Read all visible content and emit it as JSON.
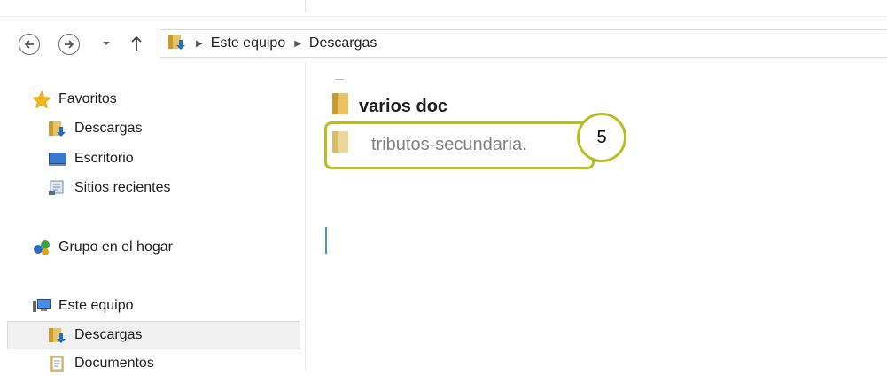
{
  "navigation": {
    "back_icon": "back-arrow-icon",
    "forward_icon": "forward-arrow-icon",
    "history_icon": "chevron-down-icon",
    "up_icon": "up-arrow-icon"
  },
  "address": {
    "segments": [
      "Este equipo",
      "Descargas"
    ]
  },
  "sidebar": {
    "favoritos": {
      "label": "Favoritos",
      "icon": "star-icon",
      "items": [
        {
          "label": "Descargas",
          "icon": "downloads-folder-icon"
        },
        {
          "label": "Escritorio",
          "icon": "desktop-icon"
        },
        {
          "label": "Sitios recientes",
          "icon": "recent-places-icon"
        }
      ]
    },
    "homegroup": {
      "label": "Grupo en el hogar",
      "icon": "homegroup-icon"
    },
    "computer": {
      "label": "Este equipo",
      "icon": "computer-icon",
      "items": [
        {
          "label": "Descargas",
          "icon": "downloads-folder-icon",
          "selected": true
        },
        {
          "label": "Documentos",
          "icon": "documents-icon"
        }
      ]
    }
  },
  "files": [
    {
      "name": "varios doc",
      "icon": "folder-icon"
    },
    {
      "name": "tributos-secundaria.",
      "icon": "folder-icon",
      "renaming": true
    }
  ],
  "annotation": {
    "label": "5",
    "color": "#b6bf1f"
  }
}
